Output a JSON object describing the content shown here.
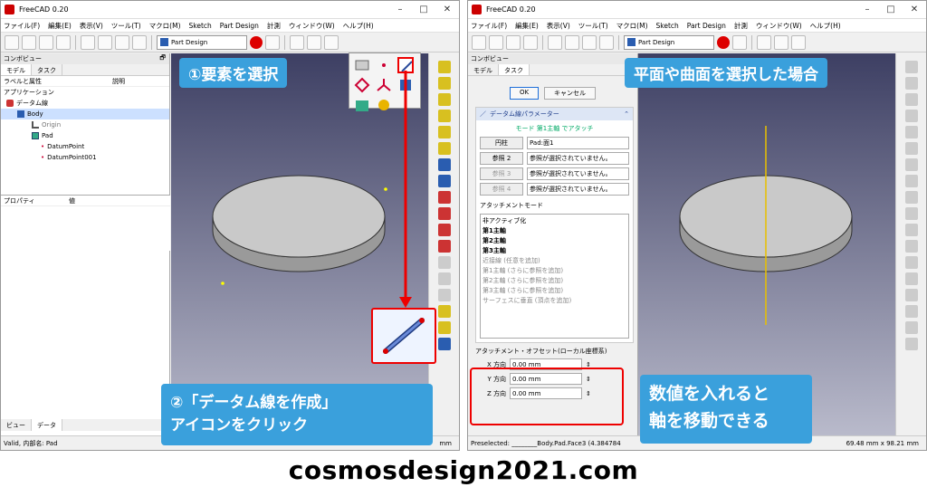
{
  "left": {
    "title": "FreeCAD 0.20",
    "menu": [
      "ファイル(F)",
      "編集(E)",
      "表示(V)",
      "ツール(T)",
      "マクロ(M)",
      "Sketch",
      "Part Design",
      "計測",
      "ウィンドウ(W)",
      "ヘルプ(H)"
    ],
    "workbench": "Part Design",
    "panel_title": "コンボビュー",
    "tabs": [
      "モデル",
      "タスク"
    ],
    "columns": [
      "ラベルと属性",
      "説明"
    ],
    "app_label": "アプリケーション",
    "tree": [
      "データム線",
      "Body",
      "Origin",
      "Pad",
      "DatumPoint",
      "DatumPoint001"
    ],
    "props_columns": [
      "プロパティ",
      "値"
    ],
    "bottom_tabs": [
      "ビュー",
      "データ"
    ],
    "status": "Valid, 内部名: Pad",
    "status_unit": "mm"
  },
  "right": {
    "title": "FreeCAD 0.20",
    "menu": [
      "ファイル(F)",
      "編集(E)",
      "表示(V)",
      "ツール(T)",
      "マクロ(M)",
      "Sketch",
      "Part Design",
      "計測",
      "ウィンドウ(W)",
      "ヘルプ(H)"
    ],
    "workbench": "Part Design",
    "panel_title": "コンボビュー",
    "tabs": [
      "モデル",
      "タスク"
    ],
    "ok": "OK",
    "cancel": "キャンセル",
    "group_title": "データム線パラメーター",
    "mode": "モード 第1主軸 でアタッチ",
    "refs": [
      {
        "btn": "円柱",
        "val": "Pad:面1"
      },
      {
        "btn": "参照 2",
        "val": "参照が選択されていません。"
      },
      {
        "btn": "参照 3",
        "val": "参照が選択されていません。"
      },
      {
        "btn": "参照 4",
        "val": "参照が選択されていません。"
      }
    ],
    "attach_mode_label": "アタッチメントモード",
    "modes": [
      "非アクティブ化",
      "第1主軸",
      "第2主軸",
      "第3主軸",
      "近接線 (任意を追加)",
      "第1主軸 (さらに参照を追加)",
      "第2主軸 (さらに参照を追加)",
      "第3主軸 (さらに参照を追加)",
      "サーフェスに垂直 (頂点を追加)"
    ],
    "offset_label": "アタッチメント・オフセット(ローカル座標系)",
    "offsets": [
      {
        "label": "X 方向",
        "val": "0.00 mm"
      },
      {
        "label": "Y 方向",
        "val": "0.00 mm"
      },
      {
        "label": "Z 方向",
        "val": "0.00 mm"
      }
    ],
    "status": "Preselected: ________Body.Pad.Face3 (4.384784",
    "status_dim": "69.48 mm x 98.21 mm"
  },
  "callouts": {
    "step1": "①要素を選択",
    "step2_line1": "②「データム線を作成」",
    "step2_line2": "アイコンをクリック",
    "plane": "平面や曲面を選択した場合",
    "num_line1": "数値を入れると",
    "num_line2": "軸を移動できる"
  },
  "footer": "cosmosdesign2021.com",
  "colors": {
    "callout": "#3aa0dc",
    "highlight": "#e00000",
    "viewport_top": "#3d3f63"
  }
}
